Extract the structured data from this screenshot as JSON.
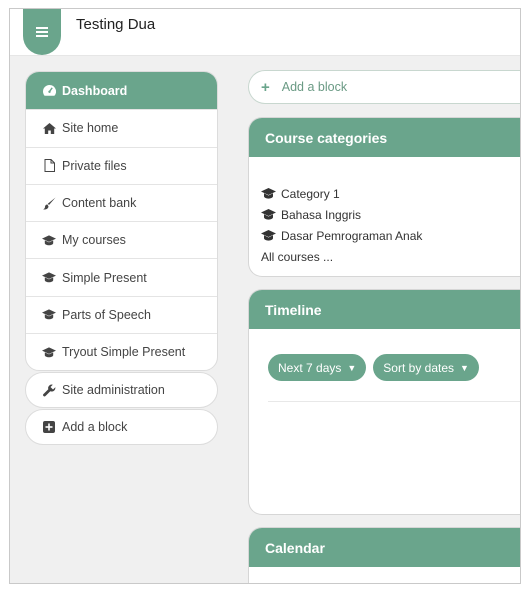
{
  "header": {
    "site_title": "Testing Dua",
    "menu_icon": "hamburger-icon"
  },
  "sidebar": {
    "items": [
      {
        "label": "Dashboard",
        "icon": "dashboard-icon",
        "active": true
      },
      {
        "label": "Site home",
        "icon": "home-icon"
      },
      {
        "label": "Private files",
        "icon": "file-icon"
      },
      {
        "label": "Content bank",
        "icon": "brush-icon"
      },
      {
        "label": "My courses",
        "icon": "graduation-cap-icon"
      },
      {
        "label": "Simple Present",
        "icon": "graduation-cap-icon"
      },
      {
        "label": "Parts of Speech",
        "icon": "graduation-cap-icon"
      },
      {
        "label": "Tryout Simple Present",
        "icon": "graduation-cap-icon"
      }
    ],
    "site_admin": {
      "label": "Site administration",
      "icon": "wrench-icon"
    },
    "add_block": {
      "label": "Add a block",
      "icon": "plus-square-icon"
    }
  },
  "main": {
    "add_block": {
      "label": "Add a block"
    },
    "course_categories": {
      "title": "Course categories",
      "items": [
        "Category 1",
        "Bahasa Inggris",
        "Dasar Pemrograman Anak"
      ],
      "all_link": "All courses ..."
    },
    "timeline": {
      "title": "Timeline",
      "filter_range": "Next 7 days",
      "sort": "Sort by dates"
    },
    "calendar": {
      "title": "Calendar"
    }
  },
  "colors": {
    "accent": "#6aa58c",
    "background": "#f0f0f0"
  }
}
